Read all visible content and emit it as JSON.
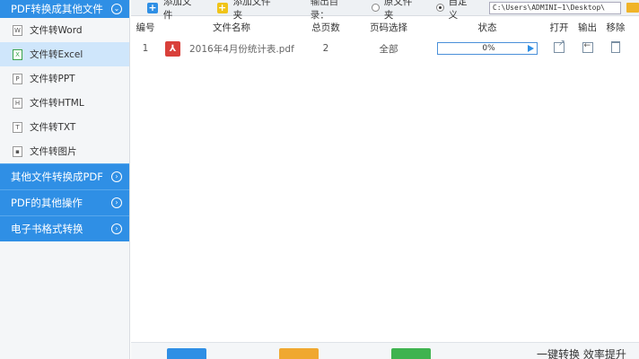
{
  "sidebar": {
    "main_section": {
      "label": "PDF转换成其他文件",
      "expand_icon": "chevron-down-icon"
    },
    "items": [
      {
        "label": "文件转Word",
        "icon": "word-file-icon",
        "active": false
      },
      {
        "label": "文件转Excel",
        "icon": "excel-file-icon",
        "active": true
      },
      {
        "label": "文件转PPT",
        "icon": "ppt-file-icon",
        "active": false
      },
      {
        "label": "文件转HTML",
        "icon": "html-file-icon",
        "active": false
      },
      {
        "label": "文件转TXT",
        "icon": "txt-file-icon",
        "active": false
      },
      {
        "label": "文件转图片",
        "icon": "image-file-icon",
        "active": false
      }
    ],
    "other_sections": [
      {
        "label": "其他文件转换成PDF",
        "icon": "chevron-right-icon"
      },
      {
        "label": "PDF的其他操作",
        "icon": "chevron-right-icon"
      },
      {
        "label": "电子书格式转换",
        "icon": "chevron-right-icon"
      }
    ]
  },
  "toolbar": {
    "add_file_label": "添加文件",
    "add_folder_label": "添加文件夹",
    "output_dir_label": "输出目录：",
    "radio_source": "原文件夹",
    "radio_custom": "自定义",
    "output_path": "C:\\Users\\ADMINI~1\\Desktop\\"
  },
  "table": {
    "headers": {
      "no": "编号",
      "name": "文件名称",
      "pages": "总页数",
      "range": "页码选择",
      "status": "状态",
      "open": "打开",
      "output": "输出",
      "remove": "移除"
    },
    "rows": [
      {
        "no": "1",
        "name": "2016年4月份统计表.pdf",
        "pages": "2",
        "range": "全部",
        "progress_text": "0%",
        "progress": 0
      }
    ]
  },
  "bottom": {
    "slogan": "一键转换 效率提升"
  },
  "colors": {
    "accent": "#2f8fe5",
    "active_item_bg": "#cfe6fb",
    "pdf_red": "#d9403a"
  }
}
